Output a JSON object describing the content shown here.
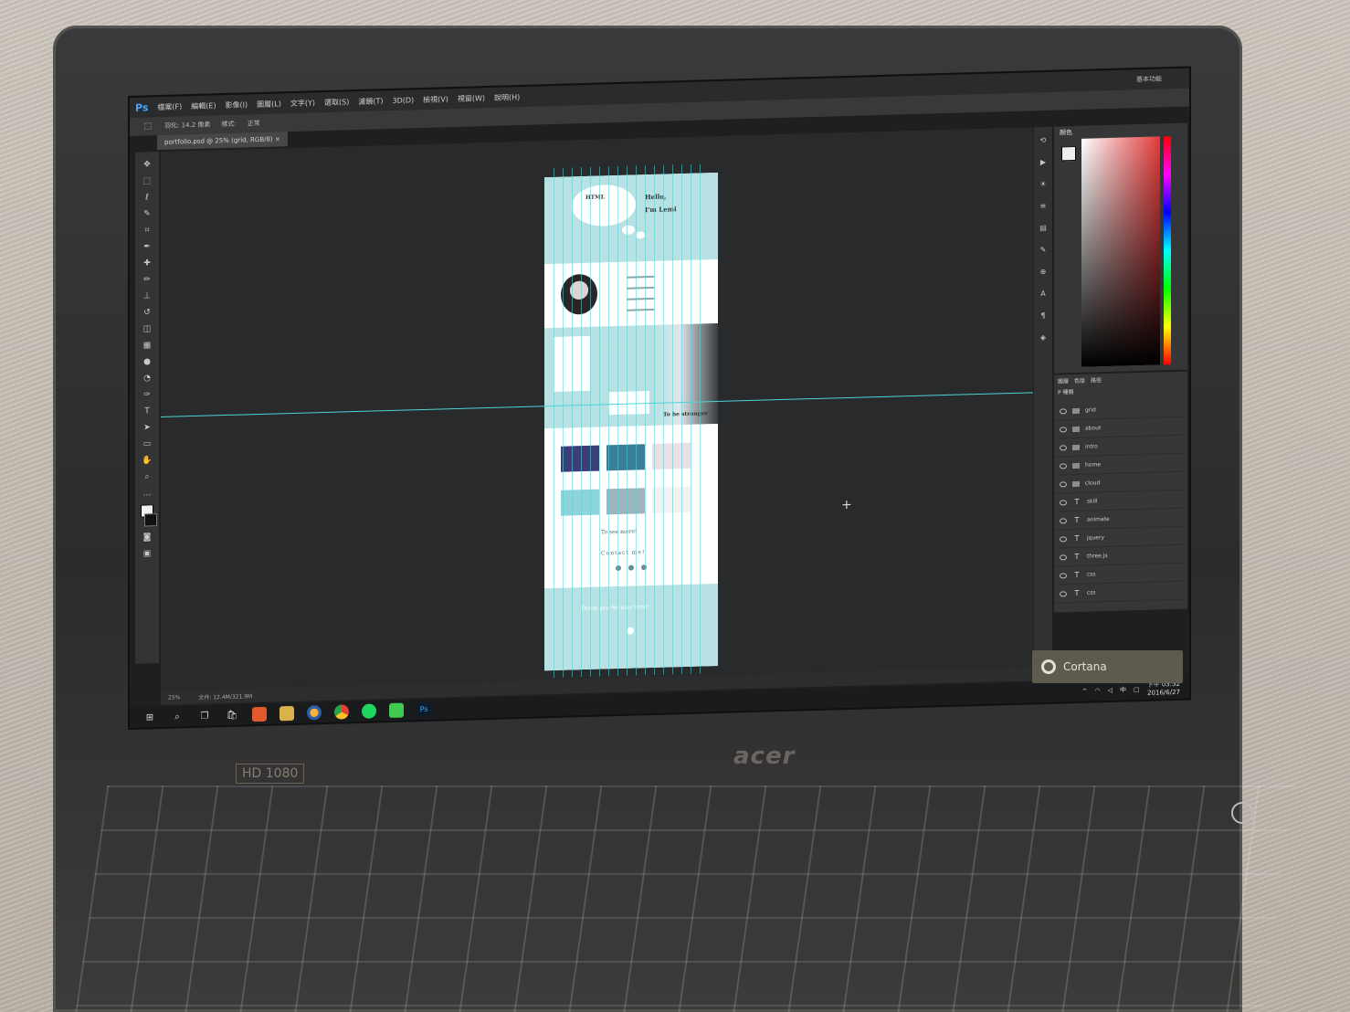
{
  "menubar": {
    "logo": "Ps",
    "items": [
      "檔案(F)",
      "編輯(E)",
      "影像(I)",
      "圖層(L)",
      "文字(Y)",
      "選取(S)",
      "濾鏡(T)",
      "3D(D)",
      "檢視(V)",
      "視窗(W)",
      "說明(H)"
    ],
    "workspace": "基本功能"
  },
  "optionsbar": {
    "feather": "羽化: 14.2 像素",
    "style_label": "樣式:",
    "style_value": "正常"
  },
  "doc_tab": "portfolio.psd @ 25% (grid, RGB/8) ×",
  "artboard": {
    "cloud_text": "HTML",
    "greeting_line1": "Hello,",
    "greeting_line2": "I'm Lemi",
    "be_stronger": "To be stronger",
    "see_more": "To see more!",
    "contact": "Contact me!",
    "footer_text": "Thank you for your time!"
  },
  "color_panel": {
    "tab": "顏色"
  },
  "layers_panel": {
    "tabs": [
      "圖層",
      "色版",
      "路徑"
    ],
    "filter": "P 種類",
    "layers": [
      {
        "kind": "folder",
        "name": "grid"
      },
      {
        "kind": "folder",
        "name": "about"
      },
      {
        "kind": "folder",
        "name": "intro"
      },
      {
        "kind": "folder",
        "name": "home"
      },
      {
        "kind": "folder",
        "name": "cloud"
      },
      {
        "kind": "text",
        "name": "skill"
      },
      {
        "kind": "text",
        "name": "animate"
      },
      {
        "kind": "text",
        "name": "jquery"
      },
      {
        "kind": "text",
        "name": "three.js"
      },
      {
        "kind": "text",
        "name": "css"
      },
      {
        "kind": "text",
        "name": "css"
      }
    ]
  },
  "statusbar": {
    "zoom": "25%",
    "doc": "文件: 12.4M/321.9M"
  },
  "taskbar": {
    "clock_time": "下午 03:52",
    "clock_date": "2016/6/27",
    "ime": "中"
  },
  "bezel": {
    "brand": "acer",
    "hd": "HD 1080",
    "cortana": "Cortana"
  }
}
